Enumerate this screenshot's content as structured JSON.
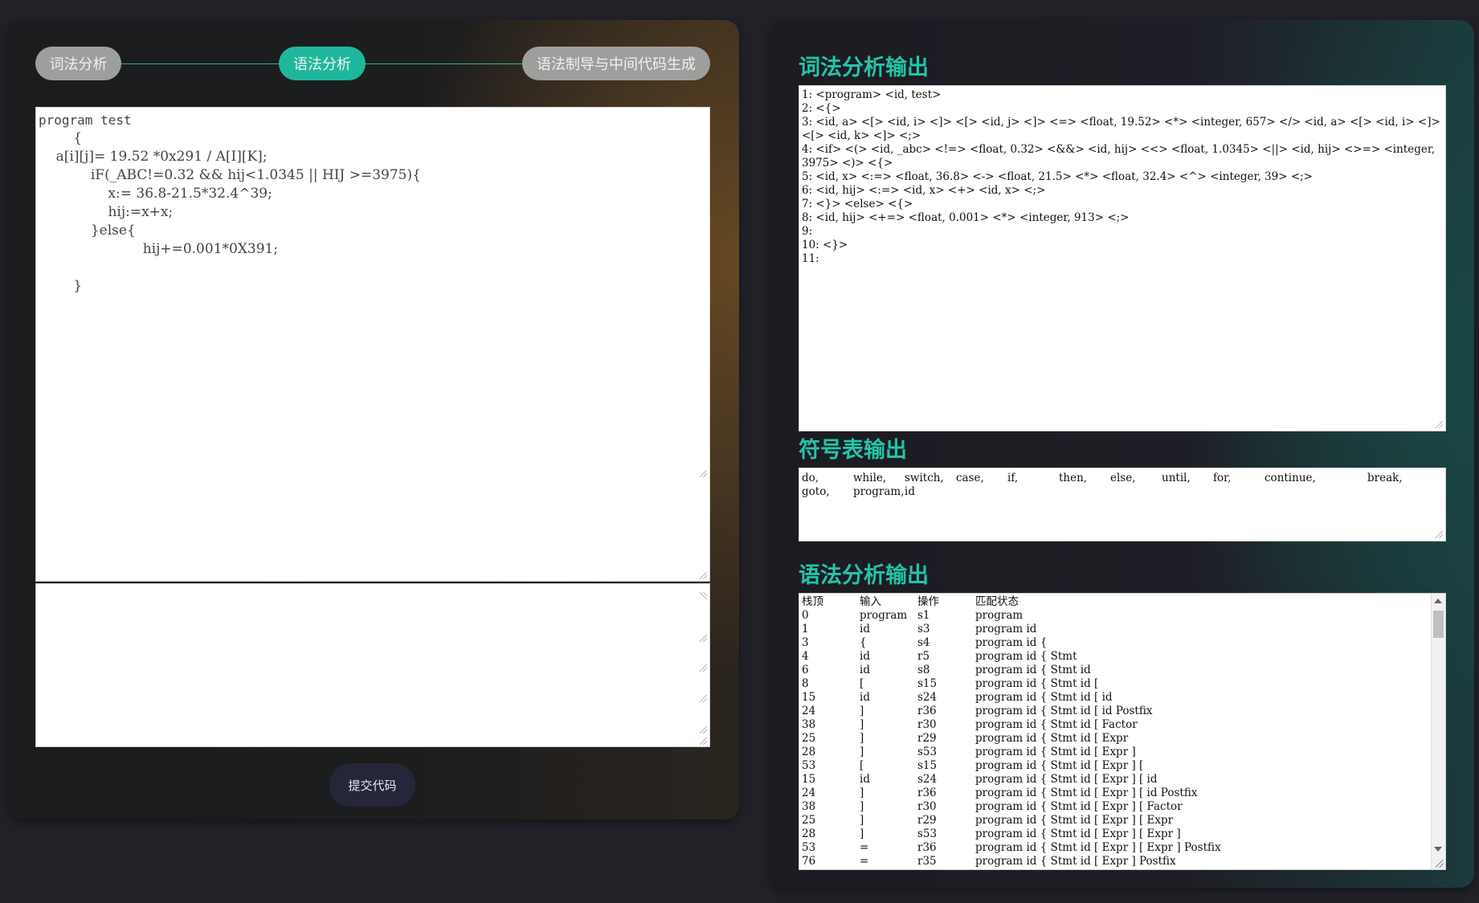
{
  "steps": {
    "lexical": "词法分析",
    "syntax": "语法分析",
    "semantic": "语法制导与中间代码生成"
  },
  "editor": {
    "code_lines": [
      "program test",
      "        {",
      "    a[i][j]= 19.52 *0x291 / A[I][K];",
      "            iF(_ABC!=0.32 && hij<1.0345 || HIJ >=3975){",
      "                x:= 36.8-21.5*32.4^39;",
      "                hij:=x+x;",
      "            }else{",
      "                        hij+=0.001*0X391;",
      "",
      "        }"
    ],
    "output": ""
  },
  "submit_label": "提交代码",
  "lex_title": "词法分析输出",
  "lex_lines": [
    "1: <program> <id, test>",
    "2: <{>",
    "3: <id, a> <[> <id, i> <]> <[> <id, j> <]> <=> <float, 19.52> <*> <integer, 657> </> <id, a> <[> <id, i> <]> <[> <id, k> <]> <;>",
    "4: <if> <(> <id, _abc> <!=> <float, 0.32> <&&> <id, hij> <<> <float, 1.0345> <||> <id, hij> <>=> <integer, 3975> <)> <{>",
    "5: <id, x> <:=> <float, 36.8> <-> <float, 21.5> <*> <float, 32.4> <^> <integer, 39> <;>",
    "6: <id, hij> <:=> <id, x> <+> <id, x> <;>",
    "7: <}> <else> <{>",
    "8: <id, hij> <+=> <float, 0.001> <*> <integer, 913> <;>",
    "9:",
    "10: <}>",
    "11:"
  ],
  "sym_title": "符号表输出",
  "symbols": [
    "do,",
    "while,",
    "switch,",
    "case,",
    "if,",
    "then,",
    "else,",
    "until,",
    "for,",
    "continue,",
    "break,",
    "goto,",
    "program,",
    "id"
  ],
  "parse_title": "语法分析输出",
  "parse_headers": [
    "栈顶",
    "输入",
    "操作",
    "匹配状态"
  ],
  "parse_rows": [
    [
      "0",
      "program",
      "s1",
      "program"
    ],
    [
      "1",
      "id",
      "s3",
      "program id"
    ],
    [
      "3",
      "{",
      "s4",
      "program id {"
    ],
    [
      "4",
      "id",
      "r5",
      "program id { Stmt"
    ],
    [
      "6",
      "id",
      "s8",
      "program id { Stmt id"
    ],
    [
      "8",
      "[",
      "s15",
      "program id { Stmt id ["
    ],
    [
      "15",
      "id",
      "s24",
      "program id { Stmt id [ id"
    ],
    [
      "24",
      "]",
      "r36",
      "program id { Stmt id [ id Postfix"
    ],
    [
      "38",
      "]",
      "r30",
      "program id { Stmt id [ Factor"
    ],
    [
      "25",
      "]",
      "r29",
      "program id { Stmt id [ Expr"
    ],
    [
      "28",
      "]",
      "s53",
      "program id { Stmt id [ Expr ]"
    ],
    [
      "53",
      "[",
      "s15",
      "program id { Stmt id [ Expr ] ["
    ],
    [
      "15",
      "id",
      "s24",
      "program id { Stmt id [ Expr ] [ id"
    ],
    [
      "24",
      "]",
      "r36",
      "program id { Stmt id [ Expr ] [ id Postfix"
    ],
    [
      "38",
      "]",
      "r30",
      "program id { Stmt id [ Expr ] [ Factor"
    ],
    [
      "25",
      "]",
      "r29",
      "program id { Stmt id [ Expr ] [ Expr"
    ],
    [
      "28",
      "]",
      "s53",
      "program id { Stmt id [ Expr ] [ Expr ]"
    ],
    [
      "53",
      "=",
      "r36",
      "program id { Stmt id [ Expr ] [ Expr ] Postfix"
    ],
    [
      "76",
      "=",
      "r35",
      "program id { Stmt id [ Expr ] Postfix"
    ]
  ]
}
